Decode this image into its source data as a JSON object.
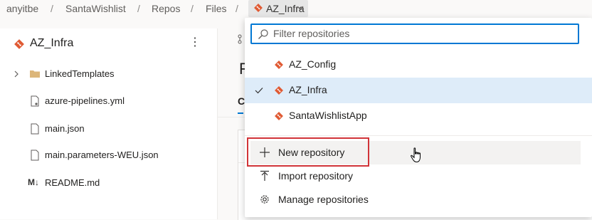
{
  "breadcrumb": {
    "items": [
      "anyitbe",
      "SantaWishlist",
      "Repos",
      "Files"
    ],
    "separator": "/",
    "current_repo": "AZ_Infra"
  },
  "left_panel": {
    "repo_name": "AZ_Infra",
    "more_label": "⋮",
    "files": [
      {
        "name": "LinkedTemplates",
        "type": "folder"
      },
      {
        "name": "azure-pipelines.yml",
        "type": "pipeline-file"
      },
      {
        "name": "main.json",
        "type": "file"
      },
      {
        "name": "main.parameters-WEU.json",
        "type": "file"
      },
      {
        "name": "README.md",
        "type": "markdown",
        "prefix": "M↓"
      }
    ]
  },
  "right_panel": {
    "heading_fragment": "F",
    "tab_fragment": "C"
  },
  "dropdown": {
    "filter_placeholder": "Filter repositories",
    "filter_value": "",
    "repos": [
      {
        "name": "AZ_Config",
        "selected": false
      },
      {
        "name": "AZ_Infra",
        "selected": true
      },
      {
        "name": "SantaWishlistApp",
        "selected": false
      }
    ],
    "actions": [
      {
        "label": "New repository",
        "icon": "plus-icon"
      },
      {
        "label": "Import repository",
        "icon": "import-icon"
      },
      {
        "label": "Manage repositories",
        "icon": "gear-icon"
      }
    ]
  },
  "colors": {
    "git_orange": "#e05a33",
    "accent_blue": "#0078d4",
    "selected_bg": "#deecf9",
    "highlight_red": "#d13438"
  }
}
